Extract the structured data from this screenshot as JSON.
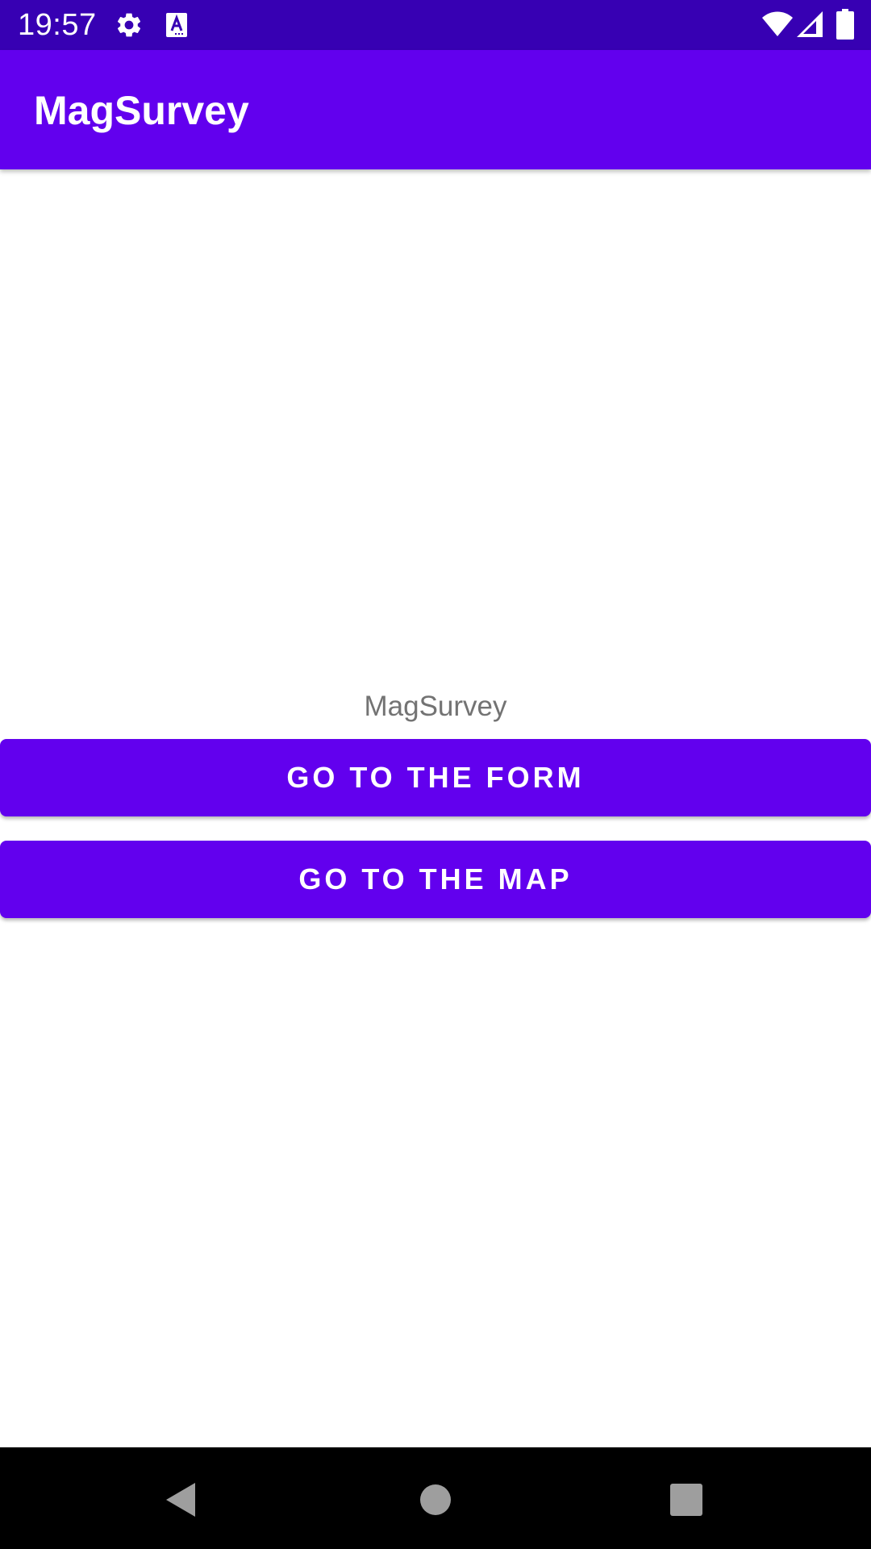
{
  "status_bar": {
    "time": "19:57",
    "icons": [
      "gear-icon",
      "text-a-icon",
      "wifi-icon",
      "signal-icon",
      "battery-icon"
    ]
  },
  "app_bar": {
    "title": "MagSurvey"
  },
  "main": {
    "label": "MagSurvey",
    "form_button_label": "GO TO THE FORM",
    "map_button_label": "GO TO THE MAP"
  },
  "nav_bar": {
    "icons": [
      "back-icon",
      "home-icon",
      "recents-icon"
    ]
  },
  "colors": {
    "status_bar": "#3700B3",
    "primary": "#6200EE",
    "label_text": "#737373"
  }
}
